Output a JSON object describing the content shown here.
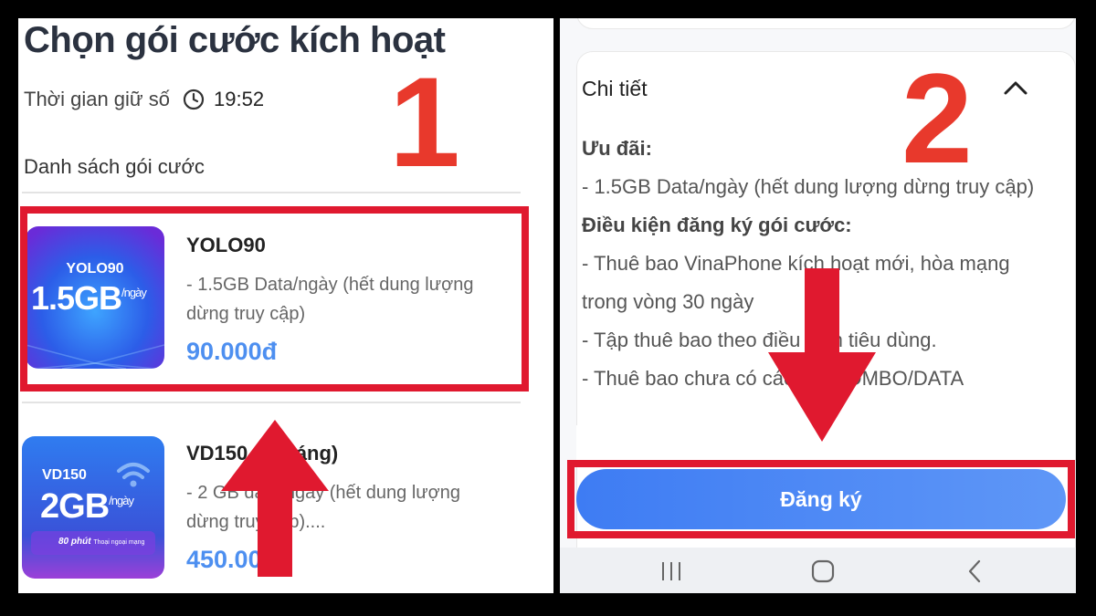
{
  "left_screen": {
    "page_title": "Chọn gói cước kích hoạt",
    "hold_label": "Thời gian giữ số",
    "hold_time": "19:52",
    "list_label": "Danh sách gói cước",
    "packages": [
      {
        "name": "YOLO90",
        "description": "- 1.5GB Data/ngày (hết dung lượng dừng truy cập)",
        "price": "90.000đ",
        "thumb_title": "YOLO90",
        "thumb_amount": "1.5GB",
        "thumb_unit": "/ngày"
      },
      {
        "name": "VD150 (1 tháng)",
        "description": "- 2 GB data/ngày (hết dung lượng dừng truy cập)....",
        "price": "450.000đ",
        "thumb_title": "VD150",
        "thumb_amount": "2GB",
        "thumb_unit": "/ngày",
        "thumb_footer": "80 phút",
        "thumb_footer_small": "Thoại ngoại mạng"
      }
    ],
    "step_number": "1"
  },
  "right_screen": {
    "section_title": "Chi tiết",
    "offer_label": "Ưu đãi:",
    "offer_line": "- 1.5GB Data/ngày (hết dung lượng dừng truy cập)",
    "conditions_label": "Điều kiện đăng ký gói cước:",
    "condition_1": "- Thuê bao VinaPhone kích hoạt mới, hòa mạng trong vòng 30 ngày",
    "condition_2": "- Tập thuê bao theo điều kiện tiêu dùng.",
    "condition_3": "- Thuê bao chưa có các gói COMBO/DATA",
    "register_button": "Đăng ký",
    "step_number": "2"
  },
  "colors": {
    "highlight_red": "#e0192f",
    "step_red": "#e8392c",
    "price_blue": "#4d8ff0",
    "button_blue": "#3e7cf3"
  },
  "icons": [
    "clock-icon",
    "chevron-up-icon",
    "recent-apps-icon",
    "home-icon",
    "back-icon",
    "arrow-up-annotation",
    "arrow-down-annotation"
  ]
}
